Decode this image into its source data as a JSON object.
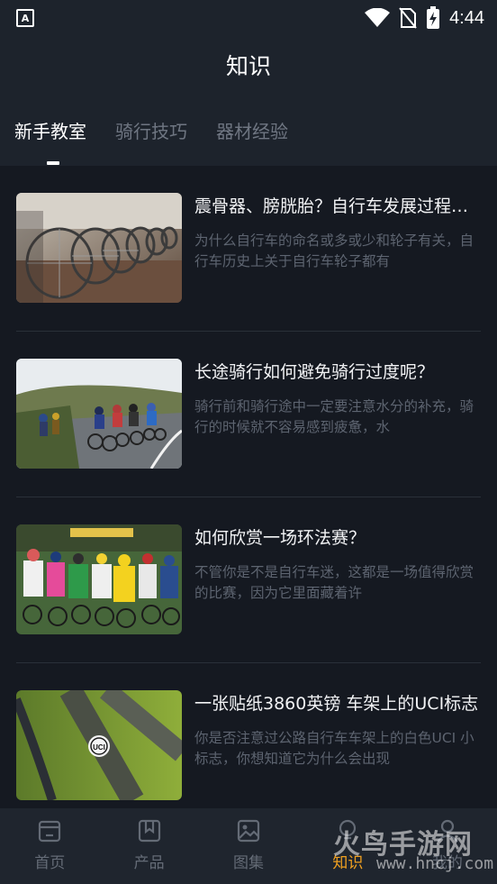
{
  "status": {
    "time": "4:44",
    "left_icon": "accessibility-a-icon"
  },
  "header": {
    "title": "知识"
  },
  "tabs": [
    {
      "label": "新手教室",
      "active": true
    },
    {
      "label": "骑行技巧",
      "active": false
    },
    {
      "label": "器材经验",
      "active": false
    }
  ],
  "articles": [
    {
      "headline": "震骨器、膀胱胎？自行车发展过程中的那些轮子",
      "summary": "为什么自行车的命名或多或少和轮子有关，自行车历史上关于自行车轮子都有",
      "image": "bicycles-parked-photo"
    },
    {
      "headline": "长途骑行如何避免骑行过度呢？",
      "summary": "骑行前和骑行途中一定要注意水分的补充，骑行的时候就不容易感到疲惫，水",
      "image": "road-race-photo"
    },
    {
      "headline": "如何欣赏一场环法赛？",
      "summary": "不管你是不是自行车迷，这都是一场值得欣赏的比赛，因为它里面藏着许",
      "image": "peloton-start-photo"
    },
    {
      "headline": "一张贴纸3860英镑 车架上的UCI标志",
      "summary": "你是否注意过公路自行车车架上的白色UCI 小标志，你想知道它为什么会出现",
      "image": "uci-frame-sticker-photo"
    }
  ],
  "bottom_nav": [
    {
      "label": "首页",
      "icon": "home-icon",
      "active": false
    },
    {
      "label": "产品",
      "icon": "bookmark-icon",
      "active": false
    },
    {
      "label": "图集",
      "icon": "image-icon",
      "active": false
    },
    {
      "label": "知识",
      "icon": "bulb-icon",
      "active": true
    },
    {
      "label": "我的",
      "icon": "user-icon",
      "active": false
    }
  ],
  "watermark": {
    "text": "火鸟手游网",
    "url": "www.hncj.com"
  },
  "colors": {
    "accent": "#f0a020",
    "background": "#151921",
    "header": "#1d232c"
  }
}
